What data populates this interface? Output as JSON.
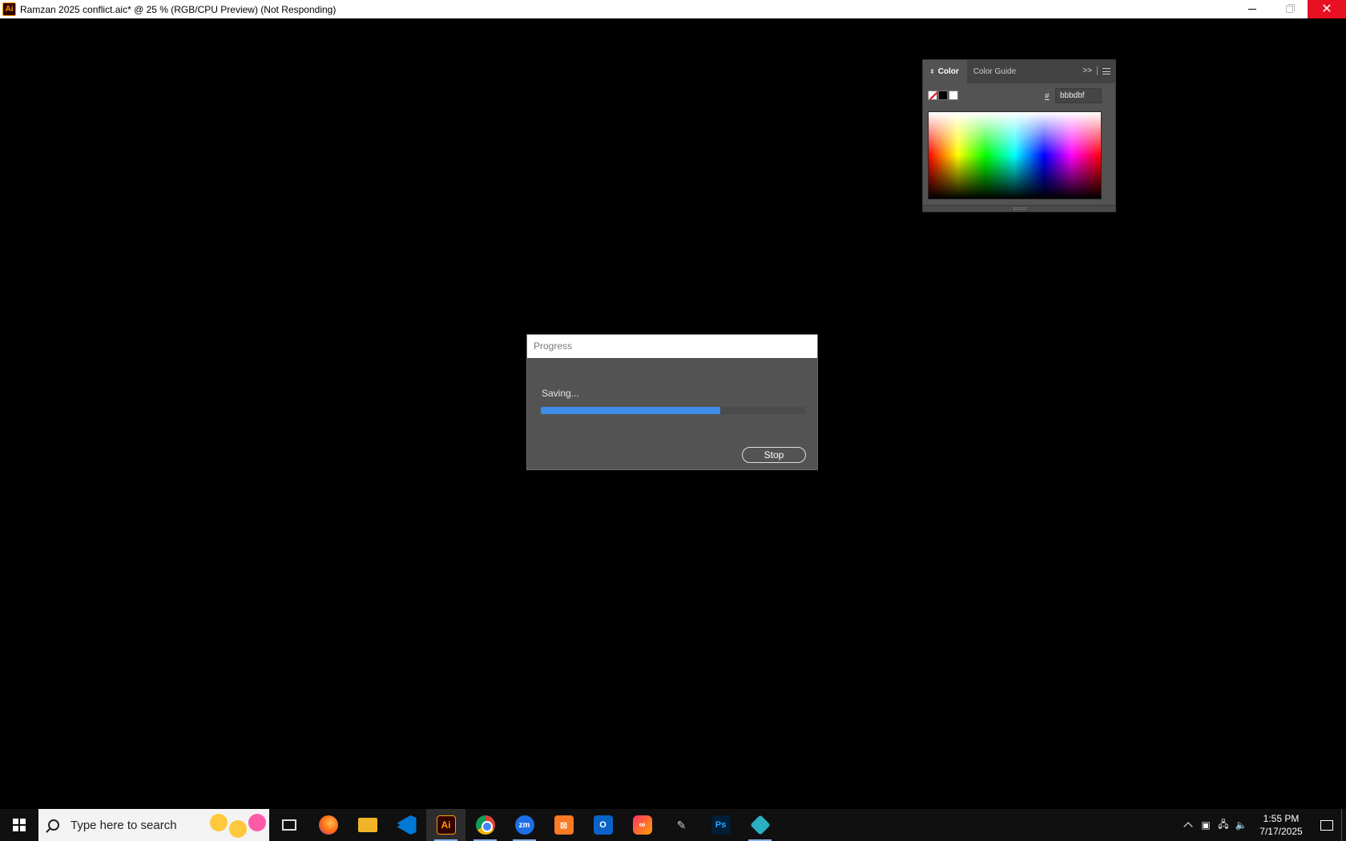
{
  "window": {
    "title": "Ramzan 2025 conflict.aic* @ 25 % (RGB/CPU Preview)  (Not Responding)",
    "app_icon": "Ai",
    "controls": {
      "minimize": "minimize-icon",
      "maximize": "restore-icon",
      "close": "✕"
    }
  },
  "color_panel": {
    "tabs": [
      {
        "label": "Color",
        "active": true
      },
      {
        "label": "Color Guide",
        "active": false
      }
    ],
    "collapse_glyph": ">>",
    "hash_label": "#",
    "hex_value": "bbbdbf",
    "swatches": [
      "none",
      "black",
      "white"
    ]
  },
  "dialog": {
    "title": "Progress",
    "status": "Saving...",
    "progress_fraction": 0.68,
    "progress_color": "#3d8ee8",
    "stop_label": "Stop"
  },
  "taskbar": {
    "search_placeholder": "Type here to search",
    "apps": [
      {
        "name": "task-view",
        "icon": "task-view-icon"
      },
      {
        "name": "firefox",
        "icon": "firefox-icon"
      },
      {
        "name": "file-explorer",
        "icon": "folder-icon"
      },
      {
        "name": "vscode",
        "icon": "vscode-icon"
      },
      {
        "name": "illustrator",
        "icon": "Ai",
        "active": true
      },
      {
        "name": "chrome",
        "icon": "chrome-icon"
      },
      {
        "name": "zoom",
        "icon": "zm"
      },
      {
        "name": "xampp",
        "icon": "xampp-icon"
      },
      {
        "name": "outlook",
        "icon": "outlook-icon"
      },
      {
        "name": "creative-cloud",
        "icon": "creative-cloud-icon"
      },
      {
        "name": "pen-tool",
        "icon": "pen-icon"
      },
      {
        "name": "photoshop",
        "icon": "Ps"
      },
      {
        "name": "app-diamond",
        "icon": "diamond-icon"
      }
    ],
    "clock": {
      "time": "1:55 PM",
      "date": "7/17/2025"
    }
  }
}
